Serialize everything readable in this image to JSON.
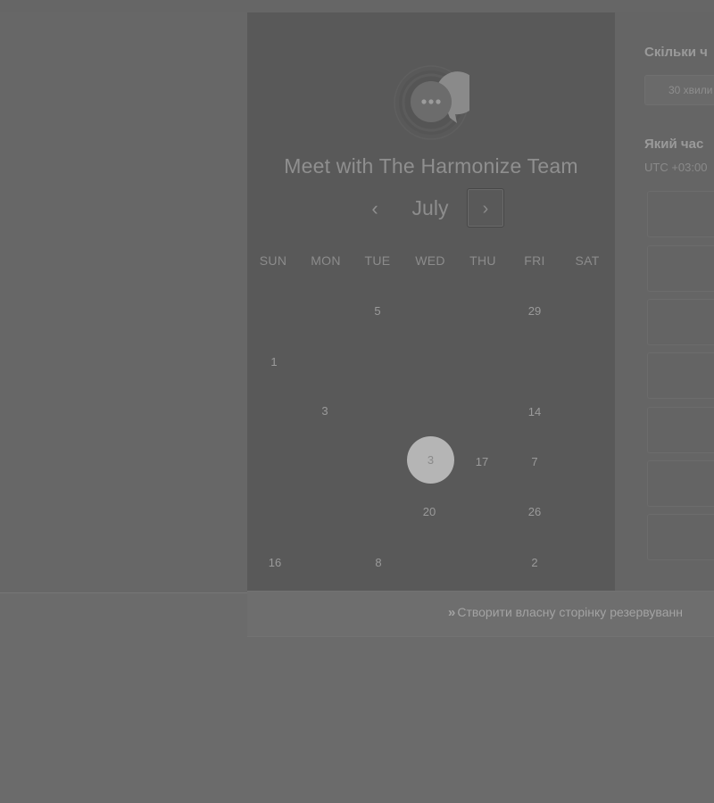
{
  "scheduler": {
    "title": "Meet with The Harmonize Team",
    "month": "July",
    "prev_icon": "chevron-left-icon",
    "next_icon": "chevron-right-icon",
    "weekdays": [
      "SUN",
      "MON",
      "TUE",
      "WED",
      "THU",
      "FRI",
      "SAT"
    ],
    "days": [
      "5",
      "29",
      "1",
      "3",
      "14",
      "3",
      "17",
      "7",
      "20",
      "26",
      "16",
      "8",
      "2"
    ],
    "selected_day": "3"
  },
  "booking": {
    "duration_heading": "Скільки ч",
    "duration_value": "30 хвили",
    "time_heading": "Який час",
    "timezone": "UTC +03:00"
  },
  "footer": {
    "link_label": "Створити власну сторінку резервуванн",
    "link_icon": "double-chevron-right-icon"
  },
  "colors": {
    "overlay": "#6b6b6b",
    "card": "#595959",
    "selected_day": "#b5b5b5"
  }
}
